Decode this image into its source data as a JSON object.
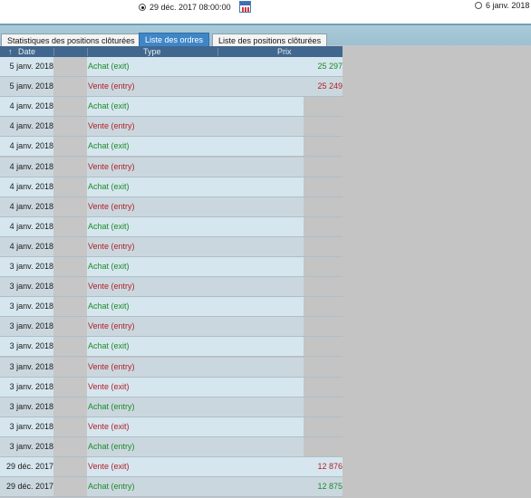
{
  "top": {
    "start_date": "29 déc. 2017 08:00:00",
    "end_date": "6 janv. 2018"
  },
  "tabs": [
    {
      "label": "Statistiques des positions clôturées"
    },
    {
      "label": "Liste des ordres"
    },
    {
      "label": "Liste des positions clôturées"
    }
  ],
  "columns": {
    "date": "Date",
    "sort_arrow": "↑",
    "type": "Type",
    "prix": "Prix"
  },
  "rows": [
    {
      "date": "5 janv. 2018",
      "type": "Achat (exit)",
      "prix": "25 297"
    },
    {
      "date": "5 janv. 2018",
      "type": "Vente (entry)",
      "prix": "25 249"
    },
    {
      "date": "4 janv. 2018",
      "type": "Achat (exit)",
      "prix": ""
    },
    {
      "date": "4 janv. 2018",
      "type": "Vente (entry)",
      "prix": ""
    },
    {
      "date": "4 janv. 2018",
      "type": "Achat (exit)",
      "prix": ""
    },
    {
      "date": "4 janv. 2018",
      "type": "Vente (entry)",
      "prix": ""
    },
    {
      "date": "4 janv. 2018",
      "type": "Achat (exit)",
      "prix": ""
    },
    {
      "date": "4 janv. 2018",
      "type": "Vente (entry)",
      "prix": ""
    },
    {
      "date": "4 janv. 2018",
      "type": "Achat (exit)",
      "prix": ""
    },
    {
      "date": "4 janv. 2018",
      "type": "Vente (entry)",
      "prix": ""
    },
    {
      "date": "3 janv. 2018",
      "type": "Achat (exit)",
      "prix": ""
    },
    {
      "date": "3 janv. 2018",
      "type": "Vente (entry)",
      "prix": ""
    },
    {
      "date": "3 janv. 2018",
      "type": "Achat (exit)",
      "prix": ""
    },
    {
      "date": "3 janv. 2018",
      "type": "Vente (entry)",
      "prix": ""
    },
    {
      "date": "3 janv. 2018",
      "type": "Achat (exit)",
      "prix": ""
    },
    {
      "date": "3 janv. 2018",
      "type": "Vente (entry)",
      "prix": ""
    },
    {
      "date": "3 janv. 2018",
      "type": "Vente (exit)",
      "prix": ""
    },
    {
      "date": "3 janv. 2018",
      "type": "Achat (entry)",
      "prix": ""
    },
    {
      "date": "3 janv. 2018",
      "type": "Vente (exit)",
      "prix": ""
    },
    {
      "date": "3 janv. 2018",
      "type": "Achat (entry)",
      "prix": ""
    },
    {
      "date": "29 déc. 2017",
      "type": "Vente (exit)",
      "prix": "12 876"
    },
    {
      "date": "29 déc. 2017",
      "type": "Achat (entry)",
      "prix": "12 875"
    }
  ],
  "colors": {
    "achat": "#1c8a2a",
    "vente": "#b0202a",
    "row_light": "#d6e6ee",
    "row_dark": "#cbd7de",
    "header": "#41678e",
    "tab_active": "#3f86c8"
  }
}
